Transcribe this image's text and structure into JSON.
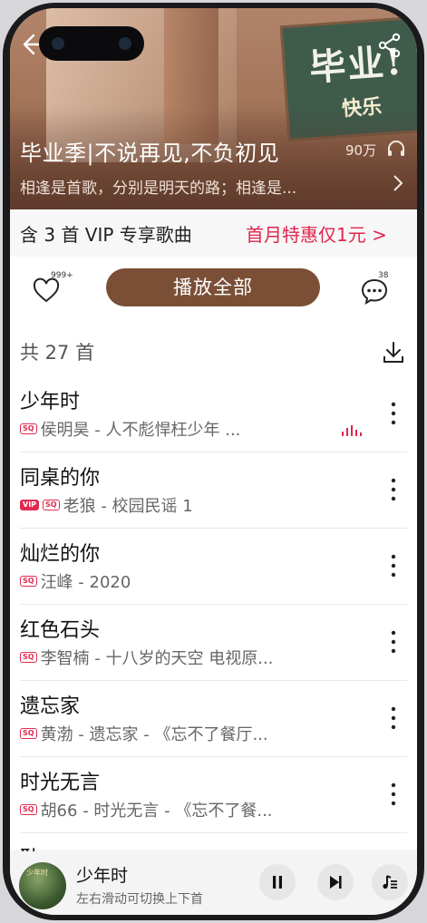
{
  "playlist": {
    "title": "毕业季|不说再见,不负初见",
    "play_count": "90万",
    "description": "相逢是首歌，分别是明天的路；相逢是...",
    "board_big": "毕业!",
    "board_small": "快乐"
  },
  "vip": {
    "text": "含 3 首 VIP 专享歌曲",
    "promo": "首月特惠仅1元 >"
  },
  "actions": {
    "like_count": "999+",
    "play_all": "播放全部",
    "comment_count": "38"
  },
  "list": {
    "total": "共 27 首",
    "partial_next": "耿"
  },
  "songs": [
    {
      "title": "少年时",
      "sub": "侯明昊 - 人不彪悍枉少年 ...",
      "badges": [
        "SQ"
      ],
      "playing": true
    },
    {
      "title": "同桌的你",
      "sub": "老狼 - 校园民谣 1",
      "badges": [
        "VIP",
        "SQ"
      ],
      "playing": false
    },
    {
      "title": "灿烂的你",
      "sub": "汪峰 - 2020",
      "badges": [
        "SQ"
      ],
      "playing": false
    },
    {
      "title": "红色石头",
      "sub": "李智楠 - 十八岁的天空 电视原...",
      "badges": [
        "SQ"
      ],
      "playing": false
    },
    {
      "title": "遗忘家",
      "sub": "黄渤 - 遗忘家 - 《忘不了餐厅...",
      "badges": [
        "SQ"
      ],
      "playing": false
    },
    {
      "title": "时光无言",
      "sub": "胡66 - 时光无言 - 《忘不了餐...",
      "badges": [
        "SQ"
      ],
      "playing": false
    }
  ],
  "player": {
    "title": "少年时",
    "hint": "左右滑动可切换上下首",
    "cover_text": "少年时"
  },
  "colors": {
    "accent": "#e0264f",
    "play_all_bg": "#7a4f36"
  },
  "icons": [
    "back-arrow-icon",
    "share-icon",
    "headphones-icon",
    "heart-icon",
    "comment-icon",
    "download-icon",
    "more-icon",
    "pause-icon",
    "next-icon",
    "playlist-icon"
  ]
}
